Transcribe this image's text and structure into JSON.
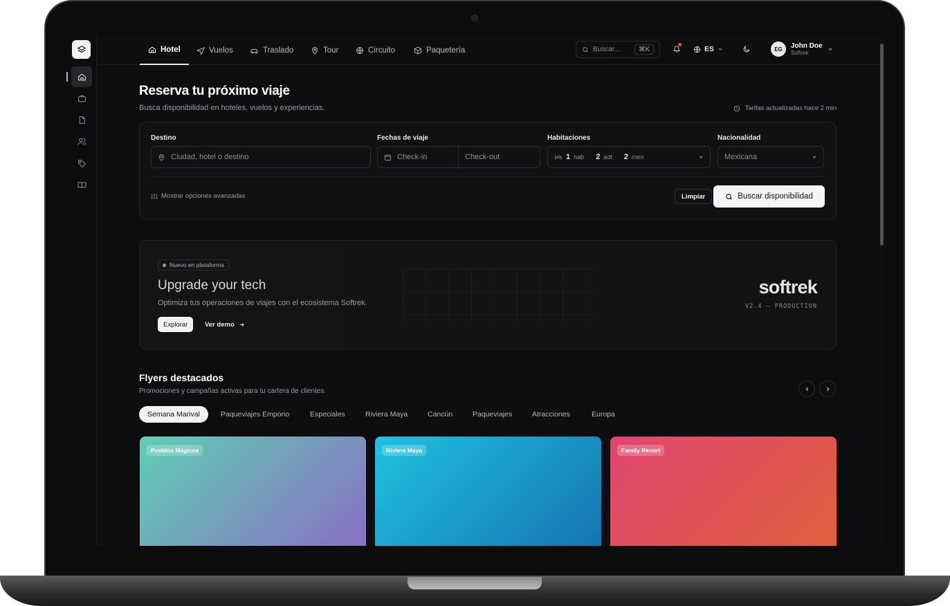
{
  "nav": {
    "tabs": [
      {
        "label": "Hotel",
        "icon": "home-icon"
      },
      {
        "label": "Vuelos",
        "icon": "plane-icon"
      },
      {
        "label": "Traslado",
        "icon": "car-icon"
      },
      {
        "label": "Tour",
        "icon": "pin-icon"
      },
      {
        "label": "Circuito",
        "icon": "globe-icon"
      },
      {
        "label": "Paquetería",
        "icon": "package-icon"
      }
    ],
    "search_placeholder": "Buscar...",
    "search_shortcut": "⌘K",
    "language": "ES",
    "user": {
      "initials": "EG",
      "name": "John Doe",
      "company": "Softrek"
    }
  },
  "page": {
    "title": "Reserva tu próximo viaje",
    "subtitle": "Busca disponibilidad en hoteles, vuelos y experiencias.",
    "rates_note": "Tarifas actualizadas hace 2 min"
  },
  "search_form": {
    "destination_label": "Destino",
    "destination_placeholder": "Ciudad, hotel o destino",
    "dates_label": "Fechas de viaje",
    "checkin_placeholder": "Check-in",
    "checkout_placeholder": "Check-out",
    "rooms_label": "Habitaciones",
    "rooms_count": "1",
    "rooms_unit": "hab",
    "adults_count": "2",
    "adults_unit": "adt",
    "minors_count": "2",
    "minors_unit": "men",
    "nationality_label": "Nacionalidad",
    "nationality_value": "Mexicana",
    "advanced_toggle": "Mostrar opciones avanzadas",
    "clear_button": "Limpiar",
    "submit_button": "Buscar disponibilidad"
  },
  "promo": {
    "badge": "Nuevo en plataforma",
    "title": "Upgrade your tech",
    "description": "Optimiza tus operaciones de viajes con el ecosistema Softrek.",
    "explore_button": "Explorar",
    "demo_link": "Ver demo",
    "brand": "softrek",
    "version": "V2.4 — PRODUCTION"
  },
  "flyers": {
    "title": "Flyers destacados",
    "subtitle": "Promociones y campañas activas para tu cartera de clientes.",
    "chips": [
      "Semana Marival",
      "Paqueviajes Emporio",
      "Especiales",
      "Riviera Maya",
      "Cancún",
      "Paqueviajes",
      "Atracciones",
      "Europa"
    ],
    "active_chip": "Semana Marival",
    "cards": [
      {
        "tag": "Pueblos Mágicos",
        "colors": [
          "#5fcfb4",
          "#8a6fc4"
        ]
      },
      {
        "tag": "Riviera Maya",
        "colors": [
          "#1fc2e0",
          "#1574b0"
        ]
      },
      {
        "tag": "Family Resort",
        "colors": [
          "#e04470",
          "#e0603c"
        ]
      }
    ]
  }
}
